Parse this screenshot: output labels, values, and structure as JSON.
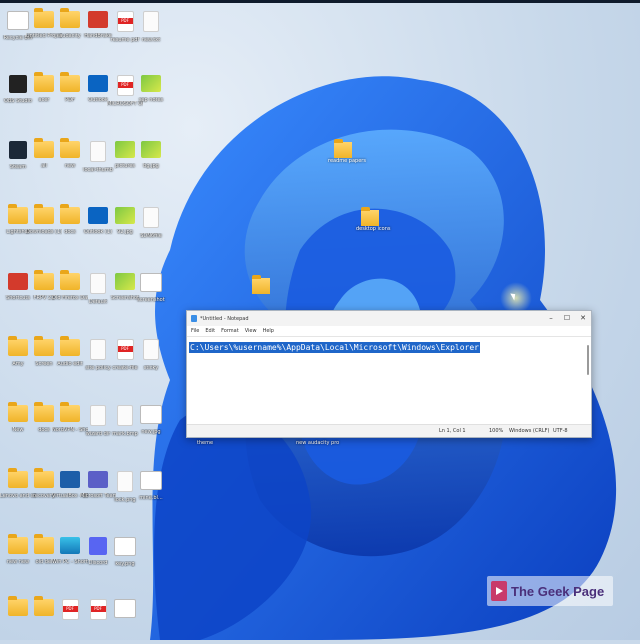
{
  "desktop": {
    "columns": [
      [
        {
          "label": "Recycle Bin",
          "icon": "recycle-bin-icon",
          "kind": "g-ps"
        },
        {
          "label": "OBS Studio",
          "icon": "obs-studio-icon",
          "kind": "g-dark"
        },
        {
          "label": "Steam",
          "icon": "steam-icon",
          "kind": "g-steam"
        },
        {
          "label": "Lightshot",
          "icon": "lightshot-icon",
          "kind": "g-folder"
        },
        {
          "label": "Shortcuts",
          "icon": "shortcut-icon",
          "kind": "g-red"
        },
        {
          "label": "Amy",
          "icon": "folder-icon",
          "kind": "g-folder"
        },
        {
          "label": "New",
          "icon": "folder-icon",
          "kind": "g-folder"
        },
        {
          "label": "Lenovo and software",
          "icon": "folder-icon",
          "kind": "g-folder"
        },
        {
          "label": "new new",
          "icon": "folder-icon",
          "kind": "g-folder"
        },
        {
          "label": "",
          "icon": "folder-icon",
          "kind": "g-folder"
        }
      ],
      [
        {
          "label": "Untitled Project",
          "icon": "folder-icon",
          "kind": "g-folder"
        },
        {
          "label": "acer",
          "icon": "folder-icon",
          "kind": "g-folder"
        },
        {
          "label": "all",
          "icon": "folder-icon",
          "kind": "g-folder"
        },
        {
          "label": "Downloads (1)",
          "icon": "folder-icon",
          "kind": "g-folder"
        },
        {
          "label": "FRPV 21",
          "icon": "folder-icon",
          "kind": "g-folder"
        },
        {
          "label": "Screen",
          "icon": "folder-icon",
          "kind": "g-folder"
        },
        {
          "label": "docs",
          "icon": "folder-icon",
          "kind": "g-folder"
        },
        {
          "label": "recovery",
          "icon": "folder-icon",
          "kind": "g-folder"
        },
        {
          "label": "old del",
          "icon": "folder-icon",
          "kind": "g-folder"
        },
        {
          "label": "",
          "icon": "folder-icon",
          "kind": "g-folder"
        }
      ],
      [
        {
          "label": "audacity",
          "icon": "folder-icon",
          "kind": "g-folder"
        },
        {
          "label": "PDF",
          "icon": "folder-icon",
          "kind": "g-folder"
        },
        {
          "label": "new",
          "icon": "folder-icon",
          "kind": "g-folder"
        },
        {
          "label": "docs",
          "icon": "folder-icon",
          "kind": "g-folder"
        },
        {
          "label": "Old Firefox Data",
          "icon": "folder-icon",
          "kind": "g-folder"
        },
        {
          "label": "Audio edit",
          "icon": "folder-icon",
          "kind": "g-folder"
        },
        {
          "label": "NordVPN - Shortcut",
          "icon": "folder-icon",
          "kind": "g-folder"
        },
        {
          "label": "VirtualBox - Shortcut",
          "icon": "virtualbox-icon",
          "kind": "g-vbox"
        },
        {
          "label": "Win PC - Shortcut",
          "icon": "app-icon",
          "kind": "g-cyan"
        },
        {
          "label": "",
          "icon": "pdf-icon",
          "kind": "g-pdf"
        }
      ],
      [
        {
          "label": "HandBrake",
          "icon": "handbrake-icon",
          "kind": "g-red"
        },
        {
          "label": "Outlook",
          "icon": "outlook-icon",
          "kind": "g-outlook"
        },
        {
          "label": "local-thumb",
          "icon": "document-icon",
          "kind": "g-doc"
        },
        {
          "label": "Outlook (1)",
          "icon": "outlook-icon",
          "kind": "g-outlook"
        },
        {
          "label": "Default",
          "icon": "document-icon",
          "kind": "g-doc"
        },
        {
          "label": "site policy",
          "icon": "document-icon",
          "kind": "g-doc"
        },
        {
          "label": "wizard dir",
          "icon": "document-icon",
          "kind": "g-doc"
        },
        {
          "label": "Microsoft Teams",
          "icon": "teams-icon",
          "kind": "g-teams"
        },
        {
          "label": "Discord",
          "icon": "discord-icon",
          "kind": "g-discord"
        },
        {
          "label": "",
          "icon": "pdf-icon",
          "kind": "g-pdf"
        }
      ],
      [
        {
          "label": "resume pdf",
          "icon": "pdf-icon",
          "kind": "g-pdf"
        },
        {
          "label": "MICROSOFT OFFICE 2021",
          "icon": "pdf-icon",
          "kind": "g-pdf"
        },
        {
          "label": "pictures",
          "icon": "image-icon",
          "kind": "g-pen"
        },
        {
          "label": "92.jpg",
          "icon": "image-icon",
          "kind": "g-pen"
        },
        {
          "label": "Screenshot",
          "icon": "image-icon",
          "kind": "g-pen"
        },
        {
          "label": "create-file",
          "icon": "pdf-icon",
          "kind": "g-pdf"
        },
        {
          "label": "mark.bmp",
          "icon": "document-icon",
          "kind": "g-doc"
        },
        {
          "label": "lock.png",
          "icon": "document-icon",
          "kind": "g-doc"
        },
        {
          "label": "key.png",
          "icon": "image-icon",
          "kind": "g-ps"
        },
        {
          "label": "",
          "icon": "app-icon",
          "kind": "g-ps"
        }
      ],
      [
        {
          "label": "new.txt",
          "icon": "document-icon",
          "kind": "g-doc"
        },
        {
          "label": "sep notes",
          "icon": "image-icon",
          "kind": "g-pen"
        },
        {
          "label": "bg.jpg",
          "icon": "image-icon",
          "kind": "g-pen"
        },
        {
          "label": "SDN6file",
          "icon": "document-icon",
          "kind": "g-doc"
        },
        {
          "label": "screenshot",
          "icon": "image-icon",
          "kind": "g-ps"
        },
        {
          "label": "sticky",
          "icon": "document-icon",
          "kind": "g-doc"
        },
        {
          "label": "new.jpg",
          "icon": "image-icon",
          "kind": "g-ps"
        },
        {
          "label": "mine.bl...",
          "icon": "image-icon",
          "kind": "g-ps"
        },
        {
          "label": "",
          "icon": "blank",
          "kind": ""
        },
        {
          "label": "",
          "icon": "blank",
          "kind": ""
        }
      ]
    ],
    "loose": [
      {
        "label": "readme papers",
        "icon": "folder-icon"
      },
      {
        "label": "desktop icons",
        "icon": "folder-icon"
      },
      {
        "label": "",
        "icon": "folder-icon"
      },
      {
        "label": "theme",
        "icon": "blank"
      },
      {
        "label": "new audacity pro",
        "icon": "blank"
      }
    ]
  },
  "notepad": {
    "title": "*Untitled - Notepad",
    "menu": [
      "File",
      "Edit",
      "Format",
      "View",
      "Help"
    ],
    "controls": [
      "–",
      "☐",
      "✕"
    ],
    "selected_text": "C:\\Users\\%username%\\AppData\\Local\\Microsoft\\Windows\\Explorer",
    "status": {
      "position": "Ln 1, Col 1",
      "zoom": "100%",
      "line_ending": "Windows (CRLF)",
      "encoding": "UTF-8"
    }
  },
  "watermark": {
    "text": "The Geek Page",
    "icon": "youtube-play-icon"
  }
}
